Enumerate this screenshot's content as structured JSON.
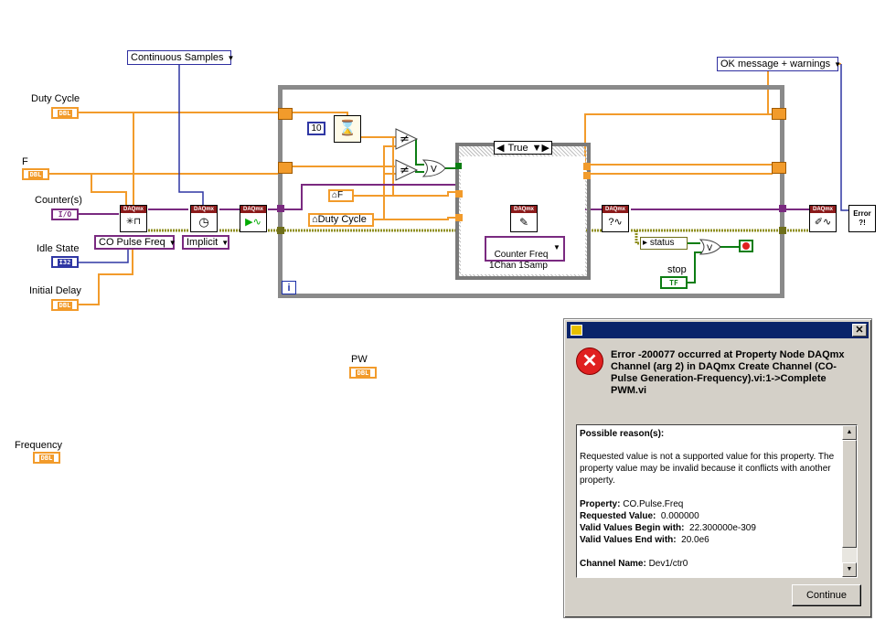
{
  "diagram": {
    "controls": {
      "duty_cycle": "Duty Cycle",
      "f": "F",
      "counters": "Counter(s)",
      "idle_state": "Idle State",
      "initial_delay": "Initial Delay",
      "pw": "PW",
      "frequency": "Frequency",
      "stop": "stop"
    },
    "terminal_types": {
      "dbl": "DBL",
      "io": "I/O",
      "i32": "I32",
      "tf": "TF"
    },
    "rings": {
      "sample_mode": "Continuous Samples",
      "channel_type": "CO Pulse Freq",
      "timing": "Implicit",
      "error_mode": "OK message + warnings",
      "write_mode": "Counter Freq\n1Chan 1Samp"
    },
    "constants": {
      "wait_ms": "10",
      "case_value": "True"
    },
    "locals": {
      "f_local": "F",
      "duty_local": "Duty Cycle"
    },
    "unbundle_status": "status",
    "vi_header": "DAQmx",
    "loop_index": "i",
    "error_vi": "Error ?!"
  },
  "dialog": {
    "title": "",
    "error_message": "Error -200077 occurred at Property Node DAQmx Channel (arg 2) in DAQmx Create Channel (CO-Pulse Generation-Frequency).vi:1->Complete PWM.vi",
    "possible_reasons_label": "Possible reason(s):",
    "reason_text": "Requested value is not a supported value for this property. The property value may be invalid because it conflicts with another property.",
    "property_label": "Property:",
    "property_value": "CO.Pulse.Freq",
    "requested_label": "Requested Value:",
    "requested_value": "0.000000",
    "begin_label": "Valid Values Begin with:",
    "begin_value": "22.300000e-309",
    "end_label": "Valid Values End with:",
    "end_value": "20.0e6",
    "channel_label": "Channel Name:",
    "channel_value": "Dev1/ctr0",
    "continue_label": "Continue",
    "close_glyph": "✕"
  },
  "colors": {
    "dbl_orange": "#f29b2b",
    "refnum_purple": "#7a2a80",
    "int_blue": "#2f37a4",
    "bool_green": "#0c7d13",
    "error_wire": "#c6c63a",
    "titlebar": "#0a246a"
  }
}
